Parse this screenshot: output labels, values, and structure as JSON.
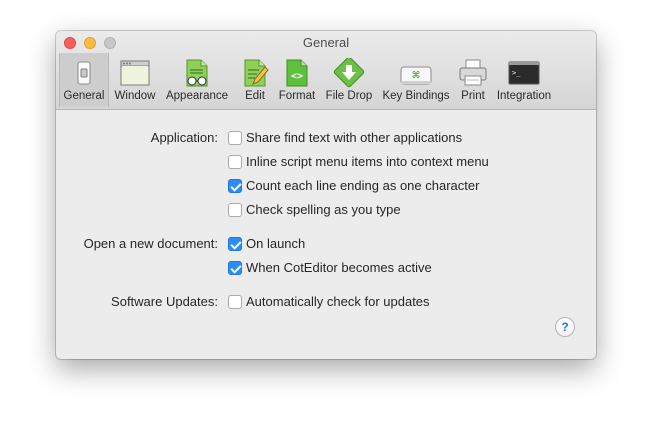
{
  "window": {
    "title": "General"
  },
  "toolbar": {
    "items": [
      {
        "label": "General",
        "icon": "general-switch-icon",
        "selected": true
      },
      {
        "label": "Window",
        "icon": "window-icon"
      },
      {
        "label": "Appearance",
        "icon": "appearance-icon"
      },
      {
        "label": "Edit",
        "icon": "edit-icon"
      },
      {
        "label": "Format",
        "icon": "format-icon"
      },
      {
        "label": "File Drop",
        "icon": "file-drop-icon"
      },
      {
        "label": "Key Bindings",
        "icon": "key-bindings-icon"
      },
      {
        "label": "Print",
        "icon": "printer-icon"
      },
      {
        "label": "Integration",
        "icon": "terminal-icon"
      }
    ]
  },
  "settings": {
    "application": {
      "label": "Application:",
      "options": [
        {
          "text": "Share find text with other applications",
          "checked": false
        },
        {
          "text": "Inline script menu items into context menu",
          "checked": false
        },
        {
          "text": "Count each line ending as one character",
          "checked": true
        },
        {
          "text": "Check spelling as you type",
          "checked": false
        }
      ]
    },
    "new_document": {
      "label": "Open a new document:",
      "options": [
        {
          "text": "On launch",
          "checked": true
        },
        {
          "text": "When CotEditor becomes active",
          "checked": true
        }
      ]
    },
    "updates": {
      "label": "Software Updates:",
      "options": [
        {
          "text": "Automatically check for updates",
          "checked": false
        }
      ]
    }
  },
  "help": {
    "glyph": "?"
  },
  "colors": {
    "accent": "#2a8cf6",
    "close": "#fc605b",
    "minimize": "#fdbc40",
    "zoom": "#c8c8c8"
  }
}
